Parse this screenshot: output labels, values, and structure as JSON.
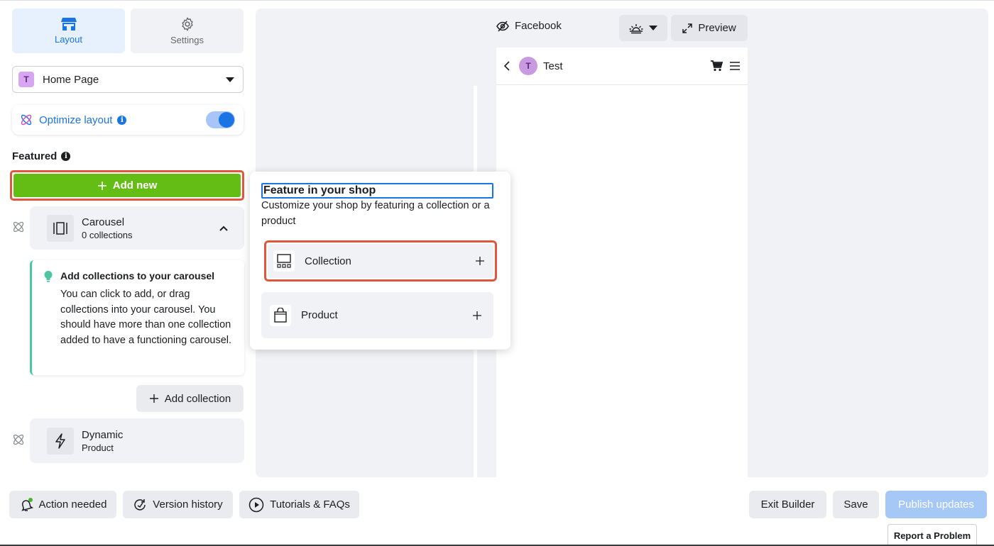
{
  "sidebar": {
    "tabs": [
      {
        "label": "Layout",
        "icon": "storefront-icon",
        "active": true
      },
      {
        "label": "Settings",
        "icon": "gear-icon",
        "active": false
      }
    ],
    "page_select": {
      "avatar": "T",
      "label": "Home Page"
    },
    "optimize": {
      "label": "Optimize layout",
      "enabled": true
    },
    "featured_label": "Featured",
    "add_new_label": "Add new",
    "carousel": {
      "title": "Carousel",
      "subtitle": "0 collections"
    },
    "tip": {
      "title": "Add collections to your carousel",
      "body": "You can click to add, or drag collections into your carousel. You should have more than one collection added to have a functioning carousel."
    },
    "add_collection_label": "Add collection",
    "dynamic": {
      "title": "Dynamic",
      "subtitle": "Product"
    }
  },
  "preview": {
    "platform_label": "Facebook",
    "preview_label": "Preview",
    "shop_avatar": "T",
    "shop_name": "Test"
  },
  "popover": {
    "title": "Feature in your shop",
    "description": "Customize your shop by featuring a collection or a product",
    "options": [
      {
        "label": "Collection"
      },
      {
        "label": "Product"
      }
    ]
  },
  "footer": {
    "action_needed": "Action needed",
    "version_history": "Version history",
    "tutorials": "Tutorials & FAQs",
    "exit": "Exit Builder",
    "save": "Save",
    "publish": "Publish updates",
    "report": "Report a Problem"
  },
  "colors": {
    "accent": "#1b74e4",
    "add_new_green": "#63bd14",
    "highlight_red": "#e0573f",
    "tip_border": "#4bc5a2"
  }
}
